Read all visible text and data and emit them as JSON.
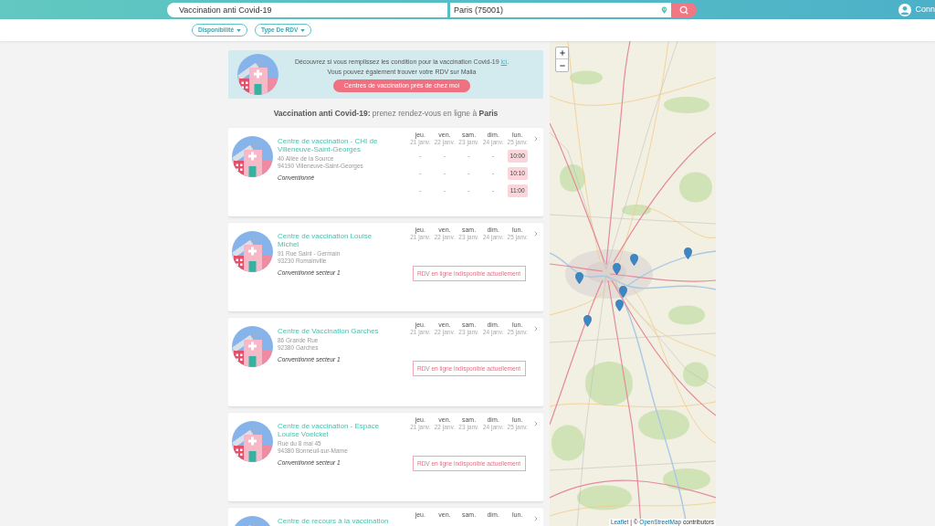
{
  "header": {
    "search": {
      "value": "Vaccination anti Covid-19"
    },
    "location": {
      "value": "Paris (75001)"
    },
    "account_label": "Conn"
  },
  "filters": [
    {
      "label": "Disponibilité"
    },
    {
      "label": "Type De RDV"
    }
  ],
  "banner": {
    "line_1": "Découvrez si vous remplissez les condition pour la vaccination Covid-19",
    "link": "ici",
    "link_suffix": ".",
    "line_2": "Vous pouvez également trouver votre RDV sur Maiia",
    "button": "Centres de vaccination près de chez moi"
  },
  "heading": "**Vaccination anti Covid-19:** prenez rendez-vous en ligne à **Paris**",
  "centers": [
    {
      "name": "Centre de vaccination - CHI de Villeneuve-Saint-Georges",
      "address_lines": [
        "40 Allée de la Source",
        "94190 Villeneuve-Saint-Georges"
      ],
      "convention": "Conventionné",
      "days": [
        {
          "day": "jeu.",
          "date": "21 janv."
        },
        {
          "day": "ven.",
          "date": "22 janv."
        },
        {
          "day": "sam.",
          "date": "23 janv."
        },
        {
          "day": "dim.",
          "date": "24 janv."
        },
        {
          "day": "lun.",
          "date": "25 janv."
        }
      ],
      "availability": {
        "kind": "slots",
        "rows": [
          [
            {
              "kind": "empty",
              "text": "-"
            },
            {
              "kind": "empty",
              "text": "-"
            },
            {
              "kind": "empty",
              "text": "-"
            },
            {
              "kind": "empty",
              "text": "-"
            },
            {
              "kind": "time",
              "text": "10:00"
            }
          ],
          [
            {
              "kind": "empty",
              "text": "-"
            },
            {
              "kind": "empty",
              "text": "-"
            },
            {
              "kind": "empty",
              "text": "-"
            },
            {
              "kind": "empty",
              "text": "-"
            },
            {
              "kind": "time",
              "text": "10:10"
            }
          ],
          [
            {
              "kind": "empty",
              "text": "-"
            },
            {
              "kind": "empty",
              "text": "-"
            },
            {
              "kind": "empty",
              "text": "-"
            },
            {
              "kind": "empty",
              "text": "-"
            },
            {
              "kind": "time",
              "text": "11:00"
            }
          ]
        ]
      }
    },
    {
      "name": "Centre de vaccination Louise Michel",
      "address_lines": [
        "91 Rue Saint - Germain",
        "93230 Romainville"
      ],
      "convention": "Conventionné secteur 1",
      "days": [
        {
          "day": "jeu.",
          "date": "21 janv."
        },
        {
          "day": "ven.",
          "date": "22 janv."
        },
        {
          "day": "sam.",
          "date": "23 janv."
        },
        {
          "day": "dim.",
          "date": "24 janv."
        },
        {
          "day": "lun.",
          "date": "25 janv."
        }
      ],
      "availability": {
        "kind": "notice",
        "text": "RDV en ligne indisponible actuellement"
      }
    },
    {
      "name": "Centre de Vaccination Garches",
      "address_lines": [
        "86 Grande Rue",
        "92380 Garches"
      ],
      "convention": "Conventionné secteur 1",
      "days": [
        {
          "day": "jeu.",
          "date": "21 janv."
        },
        {
          "day": "ven.",
          "date": "22 janv."
        },
        {
          "day": "sam.",
          "date": "23 janv."
        },
        {
          "day": "dim.",
          "date": "24 janv."
        },
        {
          "day": "lun.",
          "date": "25 janv."
        }
      ],
      "availability": {
        "kind": "notice",
        "text": "RDV en ligne indisponible actuellement"
      }
    },
    {
      "name": "Centre de vaccination - Espace Louise Voelckel",
      "address_lines": [
        "Rue du 8 mai 45",
        "94380 Bonneuil-sur-Marne"
      ],
      "convention": "Conventionné secteur 1",
      "days": [
        {
          "day": "jeu.",
          "date": "21 janv."
        },
        {
          "day": "ven.",
          "date": "22 janv."
        },
        {
          "day": "sam.",
          "date": "23 janv."
        },
        {
          "day": "dim.",
          "date": "24 janv."
        },
        {
          "day": "lun.",
          "date": "25 janv."
        }
      ],
      "availability": {
        "kind": "notice",
        "text": "RDV en ligne indisponible actuellement"
      }
    },
    {
      "name": "Centre de recours à la vaccination",
      "days": [
        {
          "day": "jeu."
        },
        {
          "day": "ven."
        },
        {
          "day": "sam."
        },
        {
          "day": "dim."
        },
        {
          "day": "lun."
        }
      ]
    }
  ],
  "map": {
    "attribution": [
      {
        "kind": "link",
        "text": "Leaflet"
      },
      {
        "kind": "text",
        "text": "| ©"
      },
      {
        "kind": "link",
        "text": "OpenStreetMap"
      },
      {
        "kind": "text",
        "text": "contributors"
      }
    ]
  }
}
